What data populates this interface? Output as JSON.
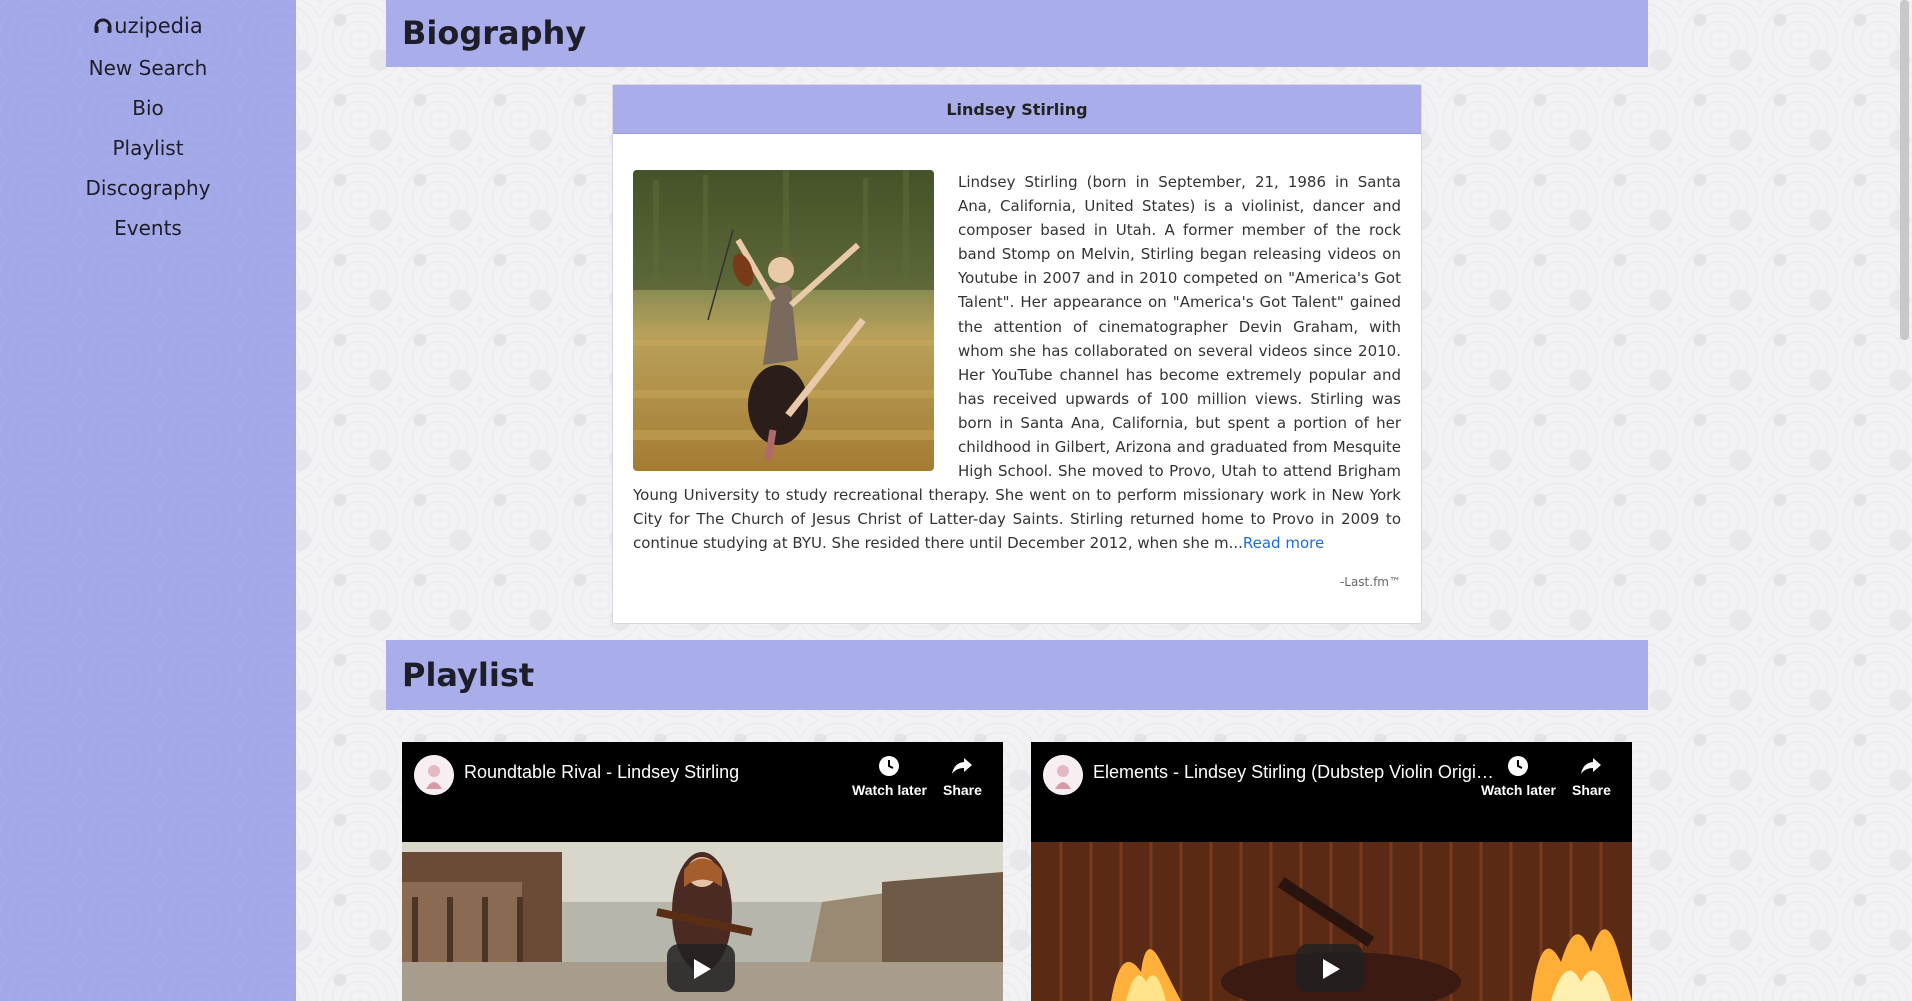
{
  "sidebar": {
    "brand": "uzipedia",
    "nav": [
      "New Search",
      "Bio",
      "Playlist",
      "Discography",
      "Events"
    ]
  },
  "biography": {
    "heading": "Biography",
    "artist_name": "Lindsey Stirling",
    "text": "Lindsey Stirling (born in September, 21, 1986 in Santa Ana, California, United States) is a violinist, dancer and composer based in Utah. A former member of the rock band Stomp on Melvin, Stirling began releasing videos on Youtube in 2007 and in 2010 competed on \"America's Got Talent\". Her appearance on \"America's Got Talent\" gained the attention of cinematographer Devin Graham, with whom she has collaborated on several videos since 2010. Her YouTube channel has become extremely popular and has received upwards of 100 million views. Stirling was born in Santa Ana, California, but spent a portion of her childhood in Gilbert, Arizona and graduated from Mesquite High School. She moved to Provo, Utah to attend Brigham Young University to study recreational therapy. She went on to perform missionary work in New York City for The Church of Jesus Christ of Latter-day Saints. Stirling returned home to Provo in 2009 to continue studying at BYU. She resided there until December 2012, when she m...",
    "read_more": "Read more",
    "credit": "-Last.fm™"
  },
  "playlist": {
    "heading": "Playlist",
    "videos": [
      {
        "title": "Roundtable Rival - Lindsey Stirling",
        "watch_later": "Watch later",
        "share": "Share"
      },
      {
        "title": "Elements - Lindsey Stirling (Dubstep Violin Original Song)",
        "watch_later": "Watch later",
        "share": "Share"
      }
    ]
  },
  "colors": {
    "sidebar": "#a2a8e8",
    "header": "#a9ade9",
    "link": "#1a6fd6"
  }
}
